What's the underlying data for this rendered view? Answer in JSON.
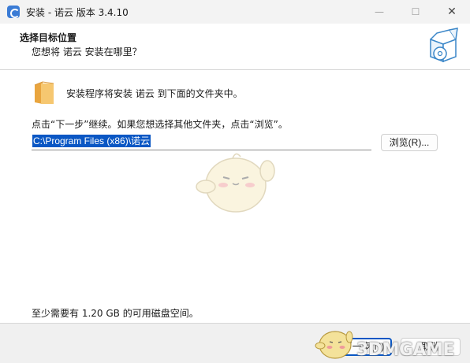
{
  "window": {
    "title": "安装 - 诺云 版本 3.4.10",
    "minimize_glyph": "—",
    "maximize_glyph": "☐",
    "close_glyph": "✕"
  },
  "header": {
    "title": "选择目标位置",
    "subtitle": "您想将 诺云 安装在哪里？"
  },
  "main": {
    "info": "安装程序将安装 诺云 到下面的文件夹中。",
    "hint": "点击“下一步”继续。如果您想选择其他文件夹，点击“浏览”。",
    "path_value": "C:\\Program Files (x86)\\诺云",
    "browse_label": "浏览(R)...",
    "space_required": "至少需要有 1.20 GB 的可用磁盘空间。"
  },
  "footer": {
    "next_label": "下一步(N)",
    "cancel_label": "取消"
  },
  "watermark": "3DMGAME",
  "colors": {
    "accent": "#0a57c4",
    "titlebar": "#f3f3f3",
    "footer": "#f0f0f0",
    "folder": "#f2b556"
  },
  "icons": [
    "app-icon",
    "box-cd-icon",
    "folder-icon",
    "mascot-image"
  ]
}
